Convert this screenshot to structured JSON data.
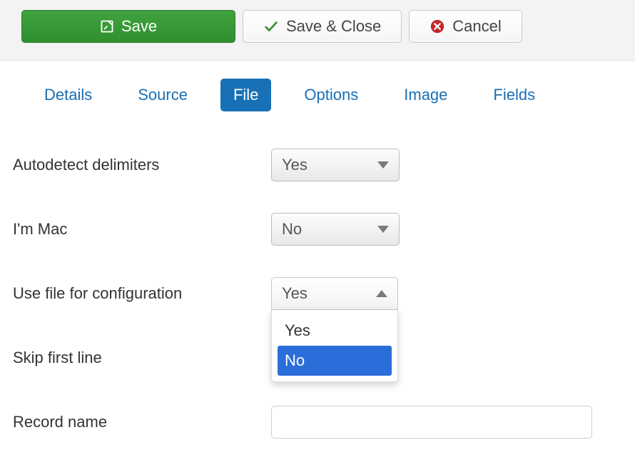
{
  "toolbar": {
    "save_label": "Save",
    "save_close_label": "Save & Close",
    "cancel_label": "Cancel"
  },
  "tabs": {
    "details": "Details",
    "source": "Source",
    "file": "File",
    "options": "Options",
    "image": "Image",
    "fields": "Fields"
  },
  "form": {
    "autodetect_label": "Autodetect delimiters",
    "autodetect_value": "Yes",
    "mac_label": "I'm Mac",
    "mac_value": "No",
    "usefile_label": "Use file for configuration",
    "usefile_value": "Yes",
    "usefile_options": {
      "yes": "Yes",
      "no": "No"
    },
    "skip_label": "Skip first line",
    "record_label": "Record name",
    "record_value": ""
  }
}
